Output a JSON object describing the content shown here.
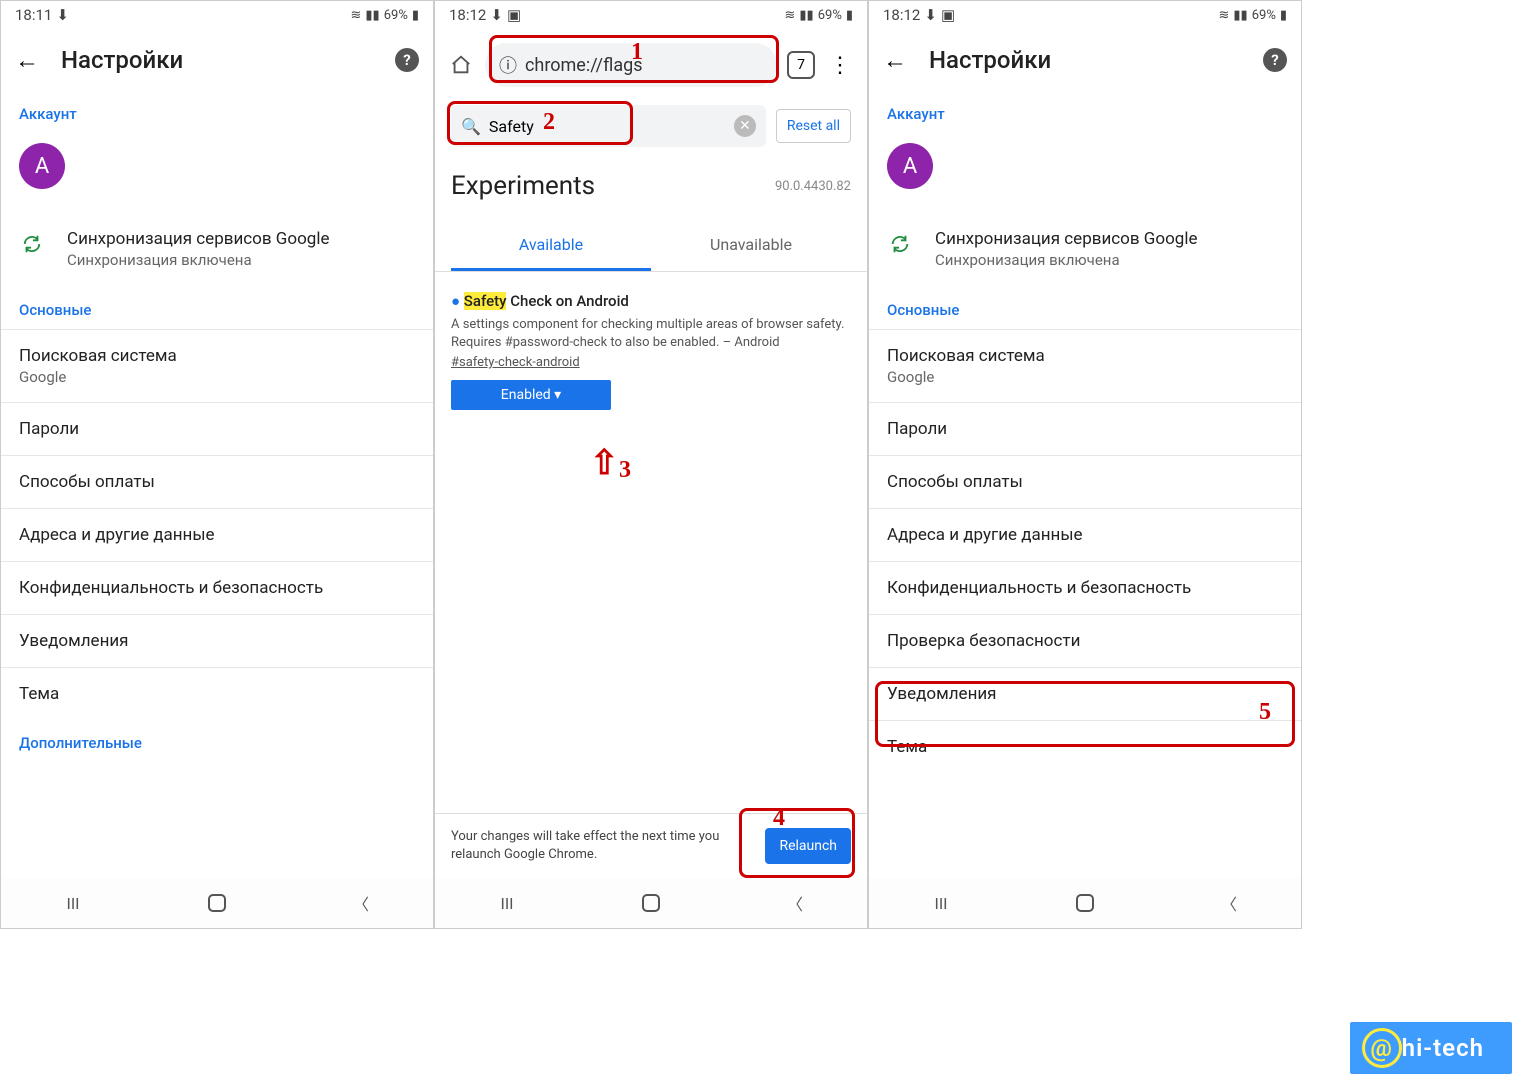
{
  "status": {
    "time1": "18:11",
    "time2": "18:12",
    "battery": "69%",
    "download_icon": "⬇",
    "wifi_icon": "≋",
    "signal_icon": "▮▮",
    "battery_icon": "▮"
  },
  "settings_header": {
    "title": "Настройки"
  },
  "sections": {
    "account": "Аккаунт",
    "basic": "Основные",
    "additional": "Дополнительные"
  },
  "avatar": {
    "letter": "А"
  },
  "sync": {
    "title": "Синхронизация сервисов Google",
    "subtitle": "Синхронизация включена"
  },
  "settings_items_left": [
    {
      "title": "Поисковая система",
      "sub": "Google"
    },
    {
      "title": "Пароли"
    },
    {
      "title": "Способы оплаты"
    },
    {
      "title": "Адреса и другие данные"
    },
    {
      "title": "Конфиденциальность и безопасность"
    },
    {
      "title": "Уведомления"
    },
    {
      "title": "Тема"
    }
  ],
  "settings_items_right": [
    {
      "title": "Поисковая система",
      "sub": "Google"
    },
    {
      "title": "Пароли"
    },
    {
      "title": "Способы оплаты"
    },
    {
      "title": "Адреса и другие данные"
    },
    {
      "title": "Конфиденциальность и безопасность"
    },
    {
      "title": "Проверка безопасности"
    },
    {
      "title": "Уведомления"
    },
    {
      "title": "Тема"
    }
  ],
  "flags": {
    "url": "chrome://flags",
    "tab_count": "7",
    "search_value": "Safety",
    "reset": "Reset all",
    "heading": "Experiments",
    "version": "90.0.4430.82",
    "tab_available": "Available",
    "tab_unavailable": "Unavailable",
    "flag_title_pre": "Safety",
    "flag_title_post": " Check on Android",
    "flag_desc": "A settings component for checking multiple areas of browser safety. Requires #password-check to also be enabled. – Android",
    "flag_anchor": "#safety-check-android",
    "enabled": "Enabled",
    "relaunch_text": "Your changes will take effect the next time you relaunch Google Chrome.",
    "relaunch_btn": "Relaunch"
  },
  "annotations": {
    "n1": "1",
    "n2": "2",
    "n3": "3",
    "n4": "4",
    "n5": "5"
  },
  "watermark": "hi-tech"
}
